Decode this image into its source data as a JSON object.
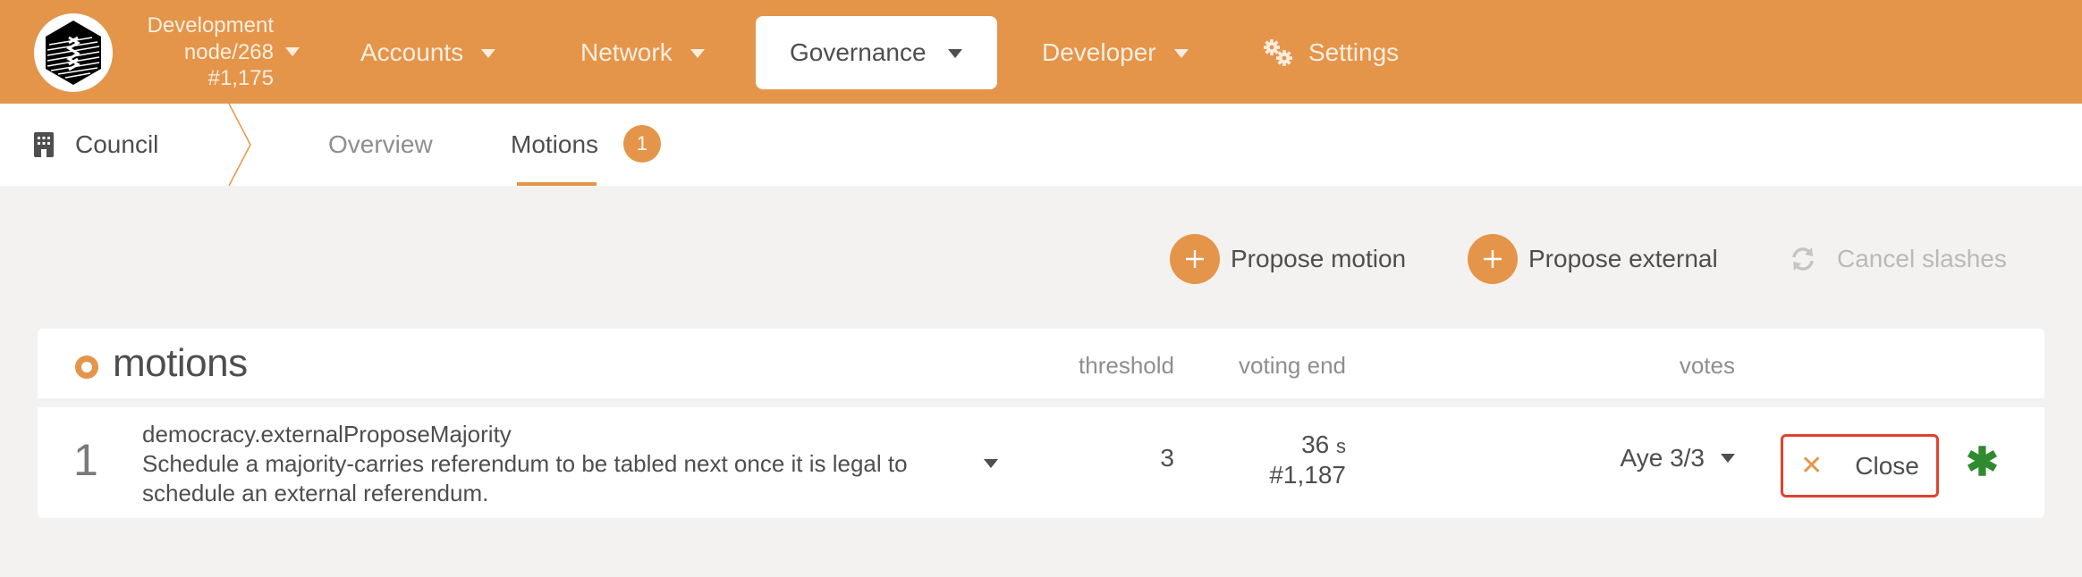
{
  "header": {
    "chain": {
      "name": "Development",
      "node": "node/268",
      "block": "#1,175"
    },
    "nav": [
      {
        "label": "Accounts",
        "has_dropdown": true
      },
      {
        "label": "Network",
        "has_dropdown": true
      },
      {
        "label": "Governance",
        "has_dropdown": true,
        "active": true
      },
      {
        "label": "Developer",
        "has_dropdown": true
      },
      {
        "label": "Settings",
        "icon": "gears-icon"
      }
    ],
    "colors": {
      "brand": "#e4954a",
      "nav_text": "#fbeee0"
    }
  },
  "subnav": {
    "section": {
      "label": "Council",
      "icon": "building-icon"
    },
    "tabs": [
      {
        "label": "Overview",
        "active": false
      },
      {
        "label": "Motions",
        "active": true,
        "badge": "1"
      }
    ]
  },
  "actions": [
    {
      "label": "Propose motion",
      "icon": "plus-icon",
      "enabled": true
    },
    {
      "label": "Propose external",
      "icon": "plus-icon",
      "enabled": true
    },
    {
      "label": "Cancel slashes",
      "icon": "refresh-icon",
      "enabled": false
    }
  ],
  "table": {
    "title": "motions",
    "columns": {
      "threshold": "threshold",
      "voting_end": "voting end",
      "votes": "votes"
    },
    "rows": [
      {
        "index": "1",
        "method": "democracy.externalProposeMajority",
        "description": "Schedule a majority-carries referendum to be tabled next once it is legal to schedule an external referendum.",
        "threshold": "3",
        "voting_end_time": "36",
        "voting_end_unit": "s",
        "voting_end_block": "#1,187",
        "votes": "Aye 3/3",
        "close_label": "Close",
        "status_icon": "asterisk-icon"
      }
    ]
  }
}
